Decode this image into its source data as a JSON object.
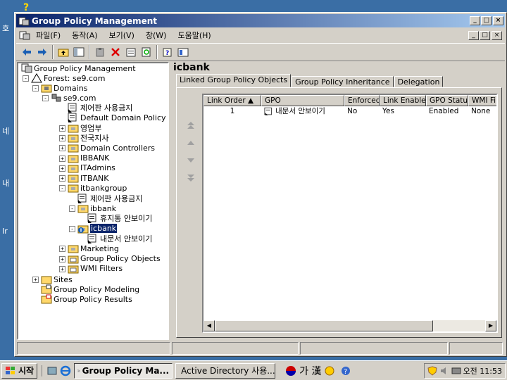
{
  "desktop_fragments": [
    "호",
    "네",
    "내",
    "Ir"
  ],
  "window": {
    "title": "Group Policy Management",
    "controls": {
      "minimize": "_",
      "maximize": "□",
      "close": "×"
    }
  },
  "menu": [
    "파일(F)",
    "동작(A)",
    "보기(V)",
    "창(W)",
    "도움말(H)"
  ],
  "tree": {
    "root": "Group Policy Management",
    "forest": "Forest: se9.com",
    "domains": "Domains",
    "domain": "se9.com",
    "items": [
      {
        "label": "제어판 사용금지",
        "type": "link"
      },
      {
        "label": "Default Domain Policy",
        "type": "link"
      },
      {
        "label": "영업부",
        "type": "ou"
      },
      {
        "label": "전국지사",
        "type": "ou"
      },
      {
        "label": "Domain Controllers",
        "type": "ou"
      },
      {
        "label": "IBBANK",
        "type": "ou"
      },
      {
        "label": "ITAdmins",
        "type": "ou"
      },
      {
        "label": "ITBANK",
        "type": "ou"
      },
      {
        "label": "itbankgroup",
        "type": "ou"
      },
      {
        "label": "제어판 사용금지",
        "type": "link"
      },
      {
        "label": "ibbank",
        "type": "ou"
      },
      {
        "label": "휴지통 안보이기",
        "type": "link"
      },
      {
        "label": "icbank",
        "type": "ou"
      },
      {
        "label": "내문서 안보이기",
        "type": "link"
      },
      {
        "label": "Marketing",
        "type": "ou"
      },
      {
        "label": "Group Policy Objects",
        "type": "folder"
      },
      {
        "label": "WMI Filters",
        "type": "folder"
      }
    ],
    "sites": "Sites",
    "modeling": "Group Policy Modeling",
    "results": "Group Policy Results"
  },
  "details": {
    "title": "icbank",
    "tabs": [
      "Linked Group Policy Objects",
      "Group Policy Inheritance",
      "Delegation"
    ],
    "columns": [
      "Link Order",
      "GPO",
      "Enforced",
      "Link Enabled",
      "GPO Status",
      "WMI Filt"
    ],
    "rows": [
      {
        "order": "1",
        "gpo": "내문서 안보이기",
        "enforced": "No",
        "link_enabled": "Yes",
        "status": "Enabled",
        "wmi": "None"
      }
    ]
  },
  "taskbar": {
    "start": "시작",
    "tasks": [
      "Group Policy Ma...",
      "Active Directory 사용..."
    ],
    "ime": "가 漢",
    "time": "오전 11:53"
  }
}
